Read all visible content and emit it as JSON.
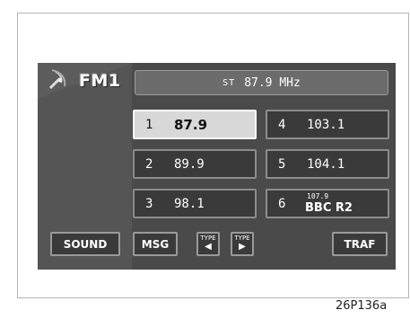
{
  "header": {
    "band": "FM1",
    "stereo_indicator": "ST",
    "frequency": "87.9 MHz"
  },
  "presets": [
    {
      "number": "1",
      "value": "87.9",
      "selected": true
    },
    {
      "number": "2",
      "value": "89.9",
      "selected": false
    },
    {
      "number": "3",
      "value": "98.1",
      "selected": false
    },
    {
      "number": "4",
      "value": "103.1",
      "selected": false
    },
    {
      "number": "5",
      "value": "104.1",
      "selected": false
    },
    {
      "number": "6",
      "value": "107.9",
      "station": "BBC R2",
      "selected": false
    }
  ],
  "controls": {
    "sound": "SOUND",
    "msg": "MSG",
    "type_label": "TYPE",
    "type_prev_arrow": "◀",
    "type_next_arrow": "▶",
    "traf": "TRAF"
  },
  "caption": "26P136a",
  "icons": {
    "band_icon": "radio-wave-icon"
  },
  "colors": {
    "screen_background": "#4a4a4a",
    "selected_preset": "#d8d8d8",
    "button_background": "#3a3a3a"
  }
}
